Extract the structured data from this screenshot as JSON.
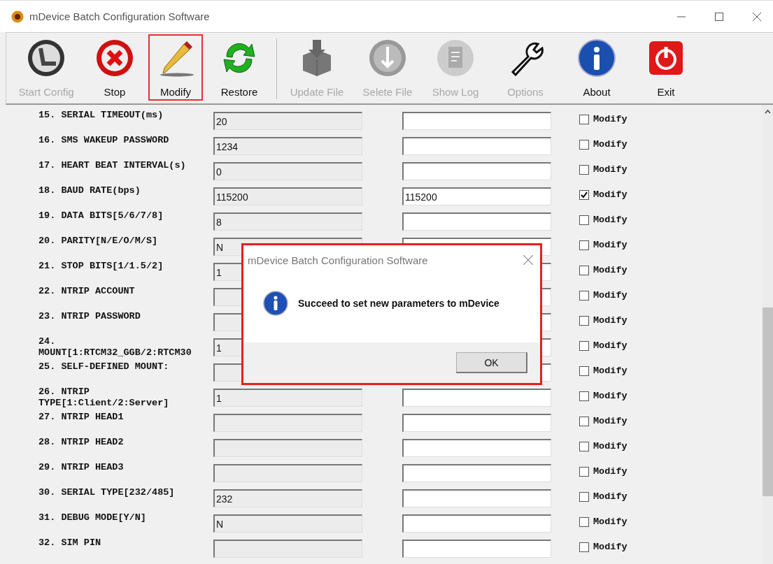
{
  "window": {
    "title": "mDevice Batch Configuration Software"
  },
  "toolbar": [
    {
      "label": "Start Config",
      "disabled": true,
      "highlighted": false
    },
    {
      "label": "Stop",
      "disabled": false,
      "highlighted": false
    },
    {
      "label": "Modify",
      "disabled": false,
      "highlighted": true
    },
    {
      "label": "Restore",
      "disabled": false,
      "highlighted": false
    },
    {
      "label": "Update File",
      "disabled": true,
      "highlighted": false
    },
    {
      "label": "Selete File",
      "disabled": true,
      "highlighted": false
    },
    {
      "label": "Show Log",
      "disabled": true,
      "highlighted": false
    },
    {
      "label": "Options",
      "disabled": true,
      "highlighted": false
    },
    {
      "label": "About",
      "disabled": false,
      "highlighted": false
    },
    {
      "label": "Exit",
      "disabled": false,
      "highlighted": false
    }
  ],
  "rows": [
    {
      "label": "15. SERIAL TIMEOUT(ms)",
      "current": "20",
      "checked": false,
      "check_label": "Modify"
    },
    {
      "label": "16. SMS WAKEUP PASSWORD",
      "current": "1234",
      "checked": false,
      "check_label": "Modify"
    },
    {
      "label": "17. HEART BEAT INTERVAL(s)",
      "current": "0",
      "checked": false,
      "check_label": "Modify"
    },
    {
      "label": "18. BAUD RATE(bps)",
      "current": "115200",
      "new": "115200",
      "checked": true,
      "check_label": "Modify"
    },
    {
      "label": "19. DATA BITS[5/6/7/8]",
      "current": "8",
      "checked": false,
      "check_label": "Modify"
    },
    {
      "label": "20. PARITY[N/E/O/M/S]",
      "current": "N",
      "checked": false,
      "check_label": "Modify"
    },
    {
      "label": "21. STOP BITS[1/1.5/2]",
      "current": "1",
      "checked": false,
      "check_label": "Modify"
    },
    {
      "label": "22. NTRIP ACCOUNT",
      "checked": false,
      "check_label": "Modify"
    },
    {
      "label": "23. NTRIP PASSWORD",
      "checked": false,
      "check_label": "Modify"
    },
    {
      "label": "24. MOUNT[1:RTCM32_GGB/2:RTCM30",
      "current": "1",
      "checked": false,
      "check_label": "Modify"
    },
    {
      "label": "25. SELF-DEFINED MOUNT:",
      "checked": false,
      "check_label": "Modify"
    },
    {
      "label": "26. NTRIP TYPE[1:Client/2:Server]",
      "current": "1",
      "checked": false,
      "check_label": "Modify"
    },
    {
      "label": "27. NTRIP HEAD1",
      "checked": false,
      "check_label": "Modify"
    },
    {
      "label": "28. NTRIP HEAD2",
      "checked": false,
      "check_label": "Modify"
    },
    {
      "label": "29. NTRIP HEAD3",
      "checked": false,
      "check_label": "Modify"
    },
    {
      "label": "30. SERIAL TYPE[232/485]",
      "current": "232",
      "checked": false,
      "check_label": "Modify"
    },
    {
      "label": "31. DEBUG MODE[Y/N]",
      "current": "N",
      "checked": false,
      "check_label": "Modify"
    },
    {
      "label": "32. SIM PIN",
      "checked": false,
      "check_label": "Modify"
    }
  ],
  "dialog": {
    "title": "mDevice Batch Configuration Software",
    "message": "Succeed to set new parameters to mDevice",
    "button": "OK",
    "highlighted": true
  }
}
